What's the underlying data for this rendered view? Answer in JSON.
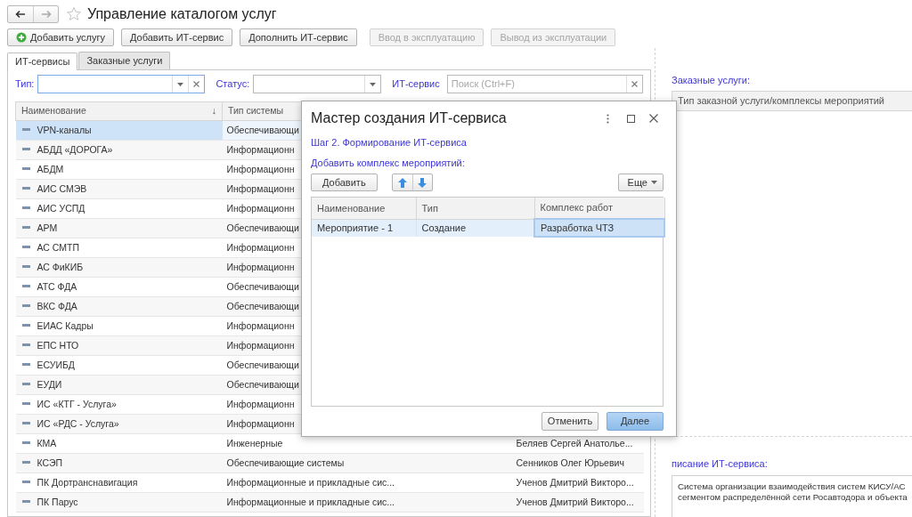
{
  "window": {
    "title": "Управление каталогом услуг"
  },
  "toolbar": [
    {
      "label": "Добавить услугу",
      "kind": "add",
      "disabled": false
    },
    {
      "label": "Добавить ИТ-сервис",
      "kind": "plain",
      "disabled": false
    },
    {
      "label": "Дополнить ИТ-сервис",
      "kind": "plain",
      "disabled": false
    },
    {
      "label": "Ввод в эксплуатацию",
      "kind": "plain",
      "disabled": true
    },
    {
      "label": "Вывод из эксплуатации",
      "kind": "plain",
      "disabled": true
    }
  ],
  "tabs": [
    {
      "label": "ИТ-сервисы",
      "selected": true
    },
    {
      "label": "Заказные услуги",
      "selected": false
    }
  ],
  "filters": {
    "type_label": "Тип:",
    "status_label": "Статус:",
    "service_label": "ИТ-сервис",
    "search_placeholder": "Поиск (Ctrl+F)"
  },
  "table": {
    "columns": [
      "Наименование",
      "Тип системы"
    ],
    "sort_mark": "↓",
    "rows": [
      {
        "name": "VPN-каналы",
        "type": "Обеспечивающи",
        "selected": true
      },
      {
        "name": "АБДД «ДОРОГА»",
        "type": "Информационн",
        "selected": false
      },
      {
        "name": "АБДМ",
        "type": "Информационн",
        "selected": false
      },
      {
        "name": "АИС СМЭВ",
        "type": "Информационн",
        "selected": false
      },
      {
        "name": "АИС УСПД",
        "type": "Информационн",
        "selected": false
      },
      {
        "name": "АРМ",
        "type": "Обеспечивающи",
        "selected": false
      },
      {
        "name": "АС СМТП",
        "type": "Информационн",
        "selected": false
      },
      {
        "name": "АС ФиКИБ",
        "type": "Информационн",
        "selected": false
      },
      {
        "name": "АТС ФДА",
        "type": "Обеспечивающи",
        "selected": false
      },
      {
        "name": "ВКС ФДА",
        "type": "Обеспечивающи",
        "selected": false
      },
      {
        "name": "ЕИАС Кадры",
        "type": "Информационн",
        "selected": false
      },
      {
        "name": "ЕПС НТО",
        "type": "Информационн",
        "selected": false
      },
      {
        "name": "ЕСУИБД",
        "type": "Обеспечивающи",
        "selected": false
      },
      {
        "name": "ЕУДИ",
        "type": "Обеспечивающи",
        "selected": false
      },
      {
        "name": "ИС «КТГ - Услуга»",
        "type": "Информационн",
        "selected": false
      },
      {
        "name": "ИС «РДС - Услуга»",
        "type": "Информационн",
        "selected": false
      },
      {
        "name": "КМА",
        "type": "Инженерные",
        "owner": "Беляев Сергей Анатолье...",
        "selected": false
      },
      {
        "name": "КСЭП",
        "type": "Обеспечивающие системы",
        "owner": "Сенников Олег Юрьевич",
        "selected": false
      },
      {
        "name": "ПК Дортранснавигация",
        "type": "Информационные и прикладные сис...",
        "owner": "Ученов Дмитрий Викторо...",
        "selected": false
      },
      {
        "name": "ПК Парус",
        "type": "Информационные и прикладные сис...",
        "owner": "Ученов Дмитрий Викторо...",
        "selected": false
      }
    ]
  },
  "right_panel": {
    "services_label": "Заказные услуги:",
    "services_column": "Тип заказной услуги/комплексы мероприятий",
    "description_label": "писание ИТ-сервиса:",
    "description_lines": [
      "Система организации взаимодействия систем КИСУ/АС",
      "сегментом распределённой сети Росавтодора и объекта"
    ]
  },
  "dialog": {
    "title": "Мастер создания ИТ-сервиса",
    "step": "Шаг 2. Формирование ИТ-сервиса",
    "list_label": "Добавить комплекс мероприятий:",
    "add_button": "Добавить",
    "more_button": "Еще",
    "table": {
      "columns": [
        "Наименование",
        "Тип",
        "Комплекс работ"
      ],
      "rows": [
        {
          "name": "Мероприятие - 1",
          "type": "Создание",
          "work": "Разработка ЧТЗ",
          "selected": true
        }
      ]
    },
    "buttons": [
      {
        "label": "Отменить",
        "kind": "secondary"
      },
      {
        "label": "Далее",
        "kind": "default"
      }
    ]
  }
}
